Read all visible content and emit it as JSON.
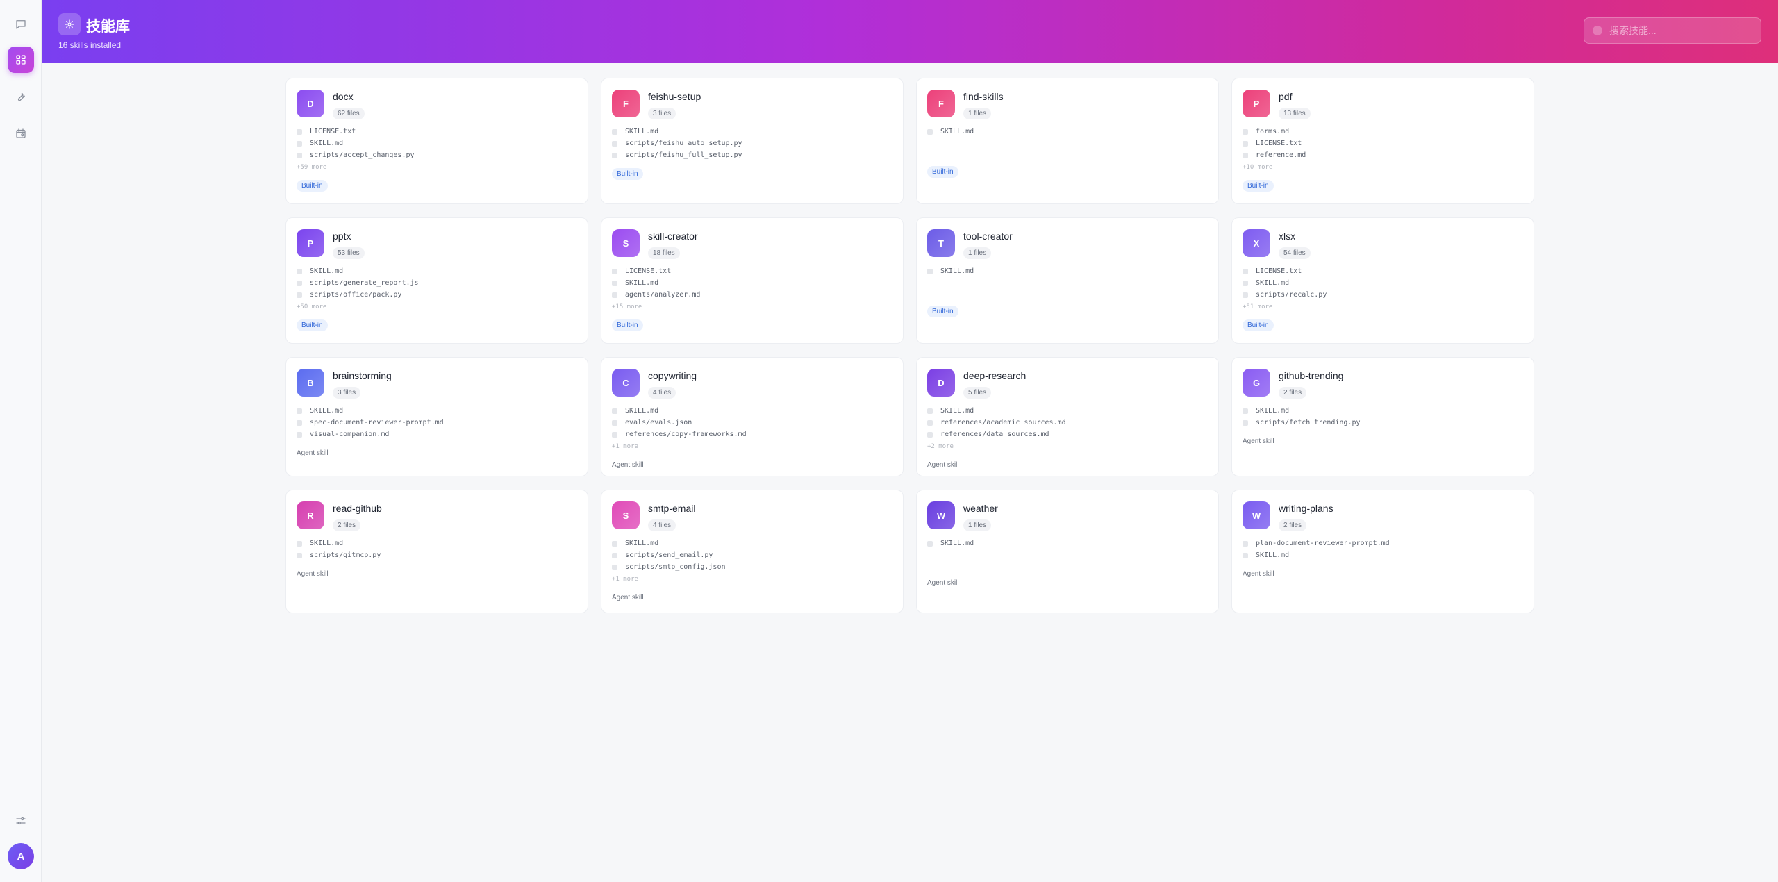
{
  "header": {
    "title": "技能库",
    "subtitle": "16 skills installed",
    "search_placeholder": "搜索技能..."
  },
  "user": {
    "avatar_letter": "A"
  },
  "sidebar": {
    "items": [
      {
        "icon": "chat-icon"
      },
      {
        "icon": "skills-grid-icon",
        "active": true
      },
      {
        "icon": "wrench-icon"
      },
      {
        "icon": "calendar-icon"
      },
      {
        "icon": "settings-sliders-icon"
      }
    ]
  },
  "skills": [
    {
      "letter": "D",
      "name": "docx",
      "count": "62 files",
      "files": [
        "LICENSE.txt",
        "SKILL.md",
        "scripts/accept_changes.py"
      ],
      "more": "+59 more",
      "tag": "Built-in",
      "color": "#8b4cf0"
    },
    {
      "letter": "F",
      "name": "feishu-setup",
      "count": "3 files",
      "files": [
        "SKILL.md",
        "scripts/feishu_auto_setup.py",
        "scripts/feishu_full_setup.py"
      ],
      "more": "",
      "tag": "Built-in",
      "color": "#ec407a"
    },
    {
      "letter": "F",
      "name": "find-skills",
      "count": "1 files",
      "files": [
        "SKILL.md"
      ],
      "more": "",
      "tag": "Built-in",
      "color": "#ec407a"
    },
    {
      "letter": "P",
      "name": "pdf",
      "count": "13 files",
      "files": [
        "forms.md",
        "LICENSE.txt",
        "reference.md"
      ],
      "more": "+10 more",
      "tag": "Built-in",
      "color": "#ec407a"
    },
    {
      "letter": "P",
      "name": "pptx",
      "count": "53 files",
      "files": [
        "SKILL.md",
        "scripts/generate_report.js",
        "scripts/office/pack.py"
      ],
      "more": "+50 more",
      "tag": "Built-in",
      "color": "#7b44ee"
    },
    {
      "letter": "S",
      "name": "skill-creator",
      "count": "18 files",
      "files": [
        "LICENSE.txt",
        "SKILL.md",
        "agents/analyzer.md"
      ],
      "more": "+15 more",
      "tag": "Built-in",
      "color": "#9b4cf0"
    },
    {
      "letter": "T",
      "name": "tool-creator",
      "count": "1 files",
      "files": [
        "SKILL.md"
      ],
      "more": "",
      "tag": "Built-in",
      "color": "#6c5ce7"
    },
    {
      "letter": "X",
      "name": "xlsx",
      "count": "54 files",
      "files": [
        "LICENSE.txt",
        "SKILL.md",
        "scripts/recalc.py"
      ],
      "more": "+51 more",
      "tag": "Built-in",
      "color": "#7e5cf0"
    },
    {
      "letter": "B",
      "name": "brainstorming",
      "count": "3 files",
      "files": [
        "SKILL.md",
        "spec-document-reviewer-prompt.md",
        "visual-companion.md"
      ],
      "more": "",
      "tag": "Agent skill",
      "color": "#5b6cf0"
    },
    {
      "letter": "C",
      "name": "copywriting",
      "count": "4 files",
      "files": [
        "SKILL.md",
        "evals/evals.json",
        "references/copy-frameworks.md"
      ],
      "more": "+1 more",
      "tag": "Agent skill",
      "color": "#7a5cf0"
    },
    {
      "letter": "D",
      "name": "deep-research",
      "count": "5 files",
      "files": [
        "SKILL.md",
        "references/academic_sources.md",
        "references/data_sources.md"
      ],
      "more": "+2 more",
      "tag": "Agent skill",
      "color": "#7b3fe4"
    },
    {
      "letter": "G",
      "name": "github-trending",
      "count": "2 files",
      "files": [
        "SKILL.md",
        "scripts/fetch_trending.py"
      ],
      "more": "",
      "tag": "Agent skill",
      "color": "#8a5cf2"
    },
    {
      "letter": "R",
      "name": "read-github",
      "count": "2 files",
      "files": [
        "SKILL.md",
        "scripts/gitmcp.py"
      ],
      "more": "",
      "tag": "Agent skill",
      "color": "#d63fb0"
    },
    {
      "letter": "S",
      "name": "smtp-email",
      "count": "4 files",
      "files": [
        "SKILL.md",
        "scripts/send_email.py",
        "scripts/smtp_config.json"
      ],
      "more": "+1 more",
      "tag": "Agent skill",
      "color": "#e04bb8"
    },
    {
      "letter": "W",
      "name": "weather",
      "count": "1 files",
      "files": [
        "SKILL.md"
      ],
      "more": "",
      "tag": "Agent skill",
      "color": "#6a3fe0"
    },
    {
      "letter": "W",
      "name": "writing-plans",
      "count": "2 files",
      "files": [
        "plan-document-reviewer-prompt.md",
        "SKILL.md"
      ],
      "more": "",
      "tag": "Agent skill",
      "color": "#7a5cf0"
    }
  ]
}
